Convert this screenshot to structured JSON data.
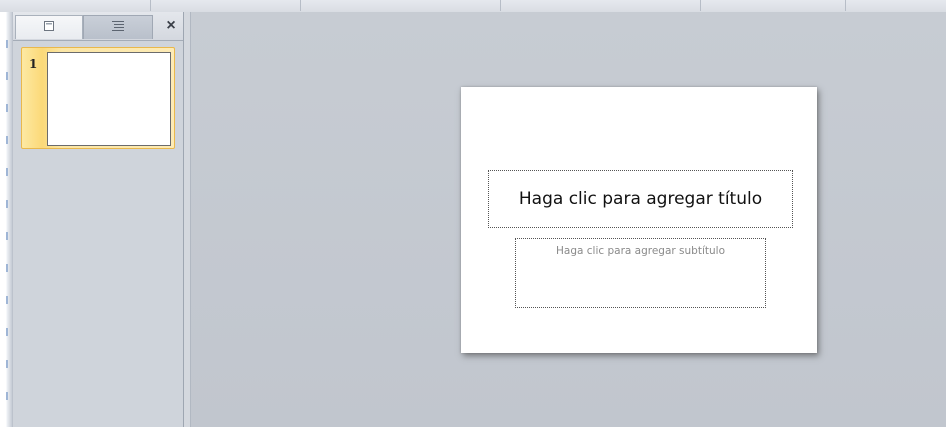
{
  "slides_panel": {
    "tabs": [
      {
        "name": "slides-tab",
        "icon": "slide-icon"
      },
      {
        "name": "outline-tab",
        "icon": "outline-lines-icon"
      }
    ],
    "close_label": "×",
    "thumbnails": [
      {
        "number": "1"
      }
    ]
  },
  "slide": {
    "title_placeholder": "Haga clic para agregar título",
    "subtitle_placeholder": "Haga clic para agregar subtítulo"
  },
  "colors": {
    "selection_highlight": "#fbd978",
    "selection_border": "#e9b84c",
    "workspace": "#c5cad1"
  }
}
